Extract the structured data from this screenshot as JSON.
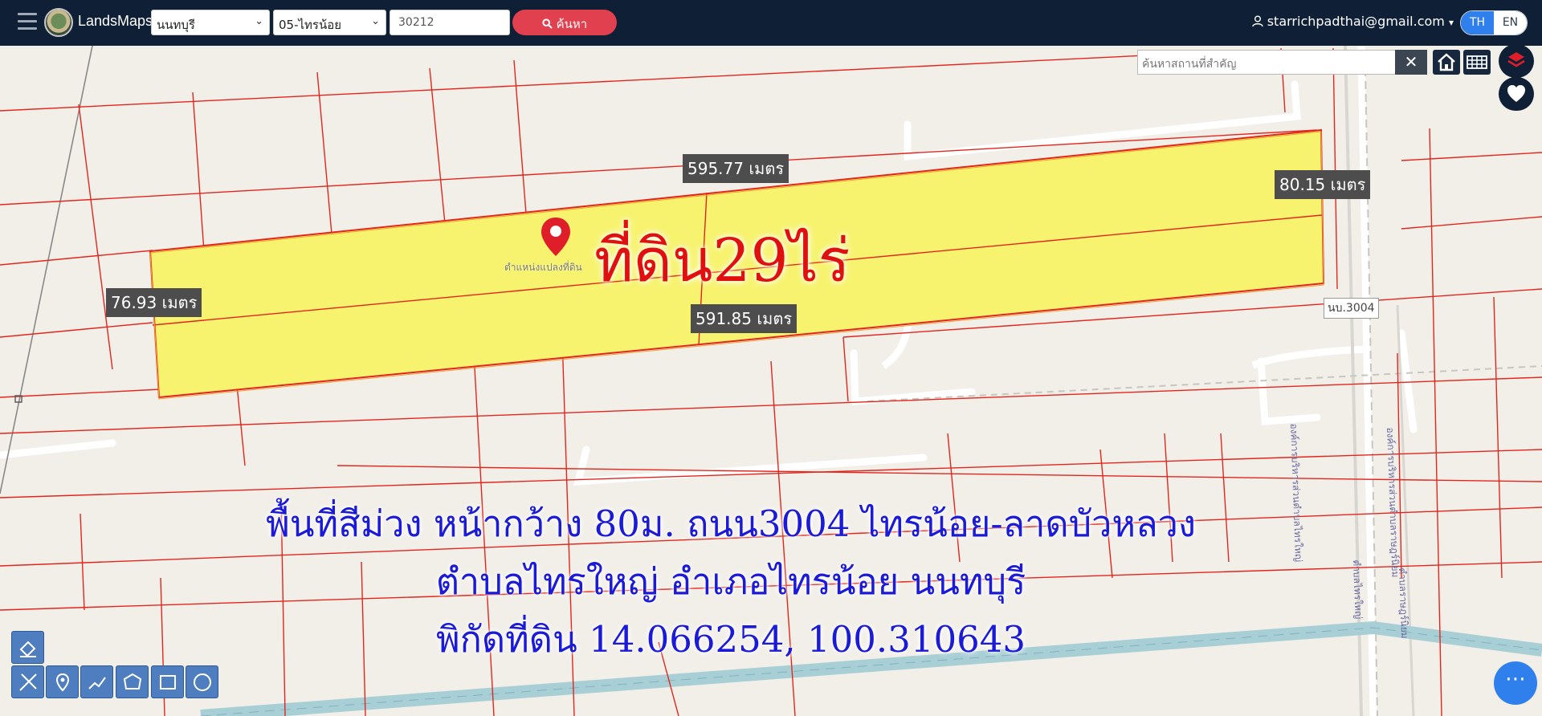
{
  "header": {
    "brand": "LandsMaps",
    "province": "นนทบุรี",
    "district": "05-ไทรน้อย",
    "parcel_no": "30212",
    "search_label": "ค้นหา",
    "user_email": "starrichpadthai@gmail.com",
    "lang_th": "TH",
    "lang_en": "EN"
  },
  "map": {
    "place_search_placeholder": "ค้นหาสถานที่สำคัญ",
    "measurements": [
      "595.77 เมตร",
      "80.15 เมตร",
      "76.93 เมตร",
      "591.85 เมตร"
    ],
    "pin_label": "ตำแหน่งแปลงที่ดิน",
    "road_label": "นบ.3004",
    "road_labels": [
      "องค์การบริหารส่วนตำบลไทรใหญ่",
      "องค์การบริหารส่วนตำบลราษฎร์นิยม",
      "ตำบลไทรใหญ่",
      "ตำบลราษฎร์นิยม"
    ],
    "title_overlay": "ที่ดิน29ไร่",
    "description_lines": [
      "พื้นที่สีม่วง หน้ากว้าง 80ม. ถนน3004 ไทรน้อย-ลาดบัวหลวง",
      "ตำบลไทรใหญ่ อำเภอไทรน้อย นนทบุรี",
      "พิกัดที่ดิน 14.066254, 100.310643"
    ]
  },
  "colors": {
    "header_bg": "#0f2036",
    "parcel_fill": "#f7f36e",
    "parcel_line": "#e2261e",
    "title_red": "#e01010",
    "desc_blue": "#1a1ad8",
    "search_btn": "#e1404f"
  },
  "icons": {
    "menu": "hamburger-icon",
    "search": "search-icon",
    "user": "user-icon",
    "clear": "close-icon",
    "home": "home-icon",
    "grid": "grid-icon",
    "layers": "layers-icon",
    "favorite": "heart-icon",
    "pin": "map-pin-icon",
    "chat": "more-icon"
  }
}
